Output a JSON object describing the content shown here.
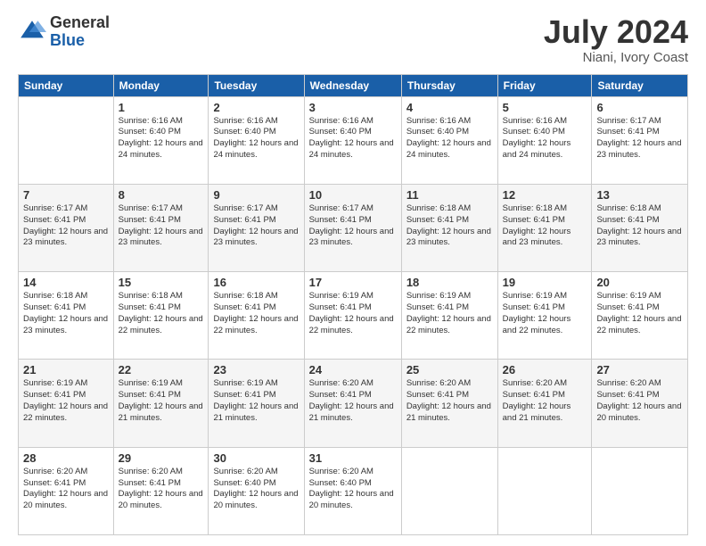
{
  "logo": {
    "general": "General",
    "blue": "Blue"
  },
  "title": "July 2024",
  "subtitle": "Niani, Ivory Coast",
  "days_of_week": [
    "Sunday",
    "Monday",
    "Tuesday",
    "Wednesday",
    "Thursday",
    "Friday",
    "Saturday"
  ],
  "weeks": [
    [
      null,
      {
        "num": "1",
        "sunrise": "6:16 AM",
        "sunset": "6:40 PM",
        "daylight": "12 hours and 24 minutes."
      },
      {
        "num": "2",
        "sunrise": "6:16 AM",
        "sunset": "6:40 PM",
        "daylight": "12 hours and 24 minutes."
      },
      {
        "num": "3",
        "sunrise": "6:16 AM",
        "sunset": "6:40 PM",
        "daylight": "12 hours and 24 minutes."
      },
      {
        "num": "4",
        "sunrise": "6:16 AM",
        "sunset": "6:40 PM",
        "daylight": "12 hours and 24 minutes."
      },
      {
        "num": "5",
        "sunrise": "6:16 AM",
        "sunset": "6:40 PM",
        "daylight": "12 hours and 24 minutes."
      },
      {
        "num": "6",
        "sunrise": "6:17 AM",
        "sunset": "6:41 PM",
        "daylight": "12 hours and 23 minutes."
      }
    ],
    [
      {
        "num": "7",
        "sunrise": "6:17 AM",
        "sunset": "6:41 PM",
        "daylight": "12 hours and 23 minutes."
      },
      {
        "num": "8",
        "sunrise": "6:17 AM",
        "sunset": "6:41 PM",
        "daylight": "12 hours and 23 minutes."
      },
      {
        "num": "9",
        "sunrise": "6:17 AM",
        "sunset": "6:41 PM",
        "daylight": "12 hours and 23 minutes."
      },
      {
        "num": "10",
        "sunrise": "6:17 AM",
        "sunset": "6:41 PM",
        "daylight": "12 hours and 23 minutes."
      },
      {
        "num": "11",
        "sunrise": "6:18 AM",
        "sunset": "6:41 PM",
        "daylight": "12 hours and 23 minutes."
      },
      {
        "num": "12",
        "sunrise": "6:18 AM",
        "sunset": "6:41 PM",
        "daylight": "12 hours and 23 minutes."
      },
      {
        "num": "13",
        "sunrise": "6:18 AM",
        "sunset": "6:41 PM",
        "daylight": "12 hours and 23 minutes."
      }
    ],
    [
      {
        "num": "14",
        "sunrise": "6:18 AM",
        "sunset": "6:41 PM",
        "daylight": "12 hours and 23 minutes."
      },
      {
        "num": "15",
        "sunrise": "6:18 AM",
        "sunset": "6:41 PM",
        "daylight": "12 hours and 22 minutes."
      },
      {
        "num": "16",
        "sunrise": "6:18 AM",
        "sunset": "6:41 PM",
        "daylight": "12 hours and 22 minutes."
      },
      {
        "num": "17",
        "sunrise": "6:19 AM",
        "sunset": "6:41 PM",
        "daylight": "12 hours and 22 minutes."
      },
      {
        "num": "18",
        "sunrise": "6:19 AM",
        "sunset": "6:41 PM",
        "daylight": "12 hours and 22 minutes."
      },
      {
        "num": "19",
        "sunrise": "6:19 AM",
        "sunset": "6:41 PM",
        "daylight": "12 hours and 22 minutes."
      },
      {
        "num": "20",
        "sunrise": "6:19 AM",
        "sunset": "6:41 PM",
        "daylight": "12 hours and 22 minutes."
      }
    ],
    [
      {
        "num": "21",
        "sunrise": "6:19 AM",
        "sunset": "6:41 PM",
        "daylight": "12 hours and 22 minutes."
      },
      {
        "num": "22",
        "sunrise": "6:19 AM",
        "sunset": "6:41 PM",
        "daylight": "12 hours and 21 minutes."
      },
      {
        "num": "23",
        "sunrise": "6:19 AM",
        "sunset": "6:41 PM",
        "daylight": "12 hours and 21 minutes."
      },
      {
        "num": "24",
        "sunrise": "6:20 AM",
        "sunset": "6:41 PM",
        "daylight": "12 hours and 21 minutes."
      },
      {
        "num": "25",
        "sunrise": "6:20 AM",
        "sunset": "6:41 PM",
        "daylight": "12 hours and 21 minutes."
      },
      {
        "num": "26",
        "sunrise": "6:20 AM",
        "sunset": "6:41 PM",
        "daylight": "12 hours and 21 minutes."
      },
      {
        "num": "27",
        "sunrise": "6:20 AM",
        "sunset": "6:41 PM",
        "daylight": "12 hours and 20 minutes."
      }
    ],
    [
      {
        "num": "28",
        "sunrise": "6:20 AM",
        "sunset": "6:41 PM",
        "daylight": "12 hours and 20 minutes."
      },
      {
        "num": "29",
        "sunrise": "6:20 AM",
        "sunset": "6:41 PM",
        "daylight": "12 hours and 20 minutes."
      },
      {
        "num": "30",
        "sunrise": "6:20 AM",
        "sunset": "6:40 PM",
        "daylight": "12 hours and 20 minutes."
      },
      {
        "num": "31",
        "sunrise": "6:20 AM",
        "sunset": "6:40 PM",
        "daylight": "12 hours and 20 minutes."
      },
      null,
      null,
      null
    ]
  ]
}
